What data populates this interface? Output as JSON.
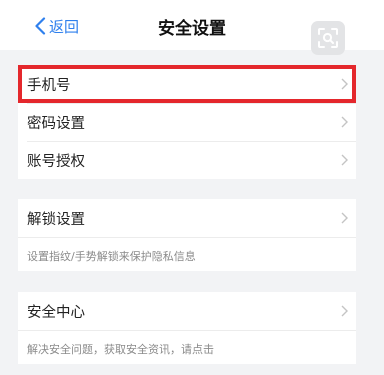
{
  "navbar": {
    "back_label": "返回",
    "title": "安全设置"
  },
  "group1": {
    "items": [
      {
        "label": "手机号"
      },
      {
        "label": "密码设置"
      },
      {
        "label": "账号授权"
      }
    ]
  },
  "group2": {
    "item_label": "解锁设置",
    "hint": "设置指纹/手势解锁来保护隐私信息"
  },
  "group3": {
    "item_label": "安全中心",
    "hint": "解决安全问题，获取安全资讯，请点击"
  },
  "colors": {
    "accent": "#2f80ed",
    "highlight": "#e4272c",
    "background": "#f2f3f5"
  },
  "icons": [
    "back-chevron-icon",
    "scan-icon",
    "chevron-right-icon"
  ]
}
